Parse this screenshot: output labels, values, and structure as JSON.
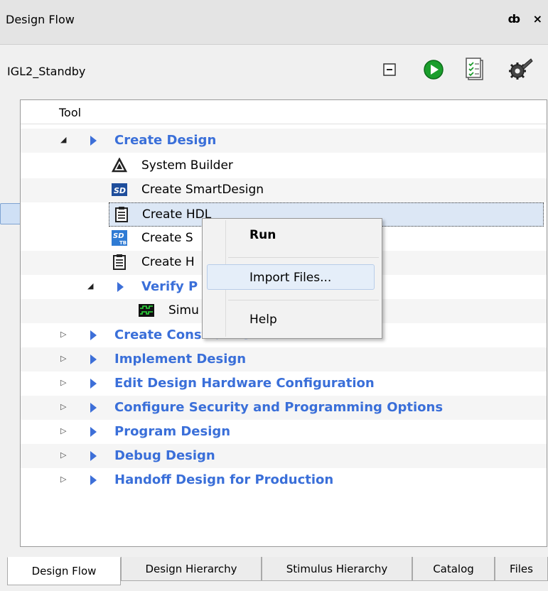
{
  "panel": {
    "title": "Design Flow",
    "window_controls": "ȸ ×"
  },
  "toolbar": {
    "project_name": "IGL2_Standby",
    "icons": [
      "collapse-icon",
      "run-icon",
      "report-icon",
      "settings-icon"
    ]
  },
  "tree": {
    "header": "Tool",
    "create_design": "Create Design",
    "system_builder": "System Builder",
    "create_smartdesign": "Create SmartDesign",
    "create_hdl": "Create HDL",
    "create_s": "Create S",
    "create_h": "Create H",
    "verify_p": "Verify P",
    "simu": "Simu",
    "groups": [
      "Create Constraints",
      "Implement Design",
      "Edit Design Hardware Configuration",
      "Configure Security and Programming Options",
      "Program Design",
      "Debug Design",
      "Handoff Design for Production"
    ]
  },
  "context_menu": {
    "run": "Run",
    "import_files": "Import Files...",
    "help": "Help"
  },
  "tabs": [
    "Design Flow",
    "Design Hierarchy",
    "Stimulus Hierarchy",
    "Catalog",
    "Files"
  ],
  "colors": {
    "group_text": "#3a6fd9",
    "selection": "#dce7f5"
  }
}
